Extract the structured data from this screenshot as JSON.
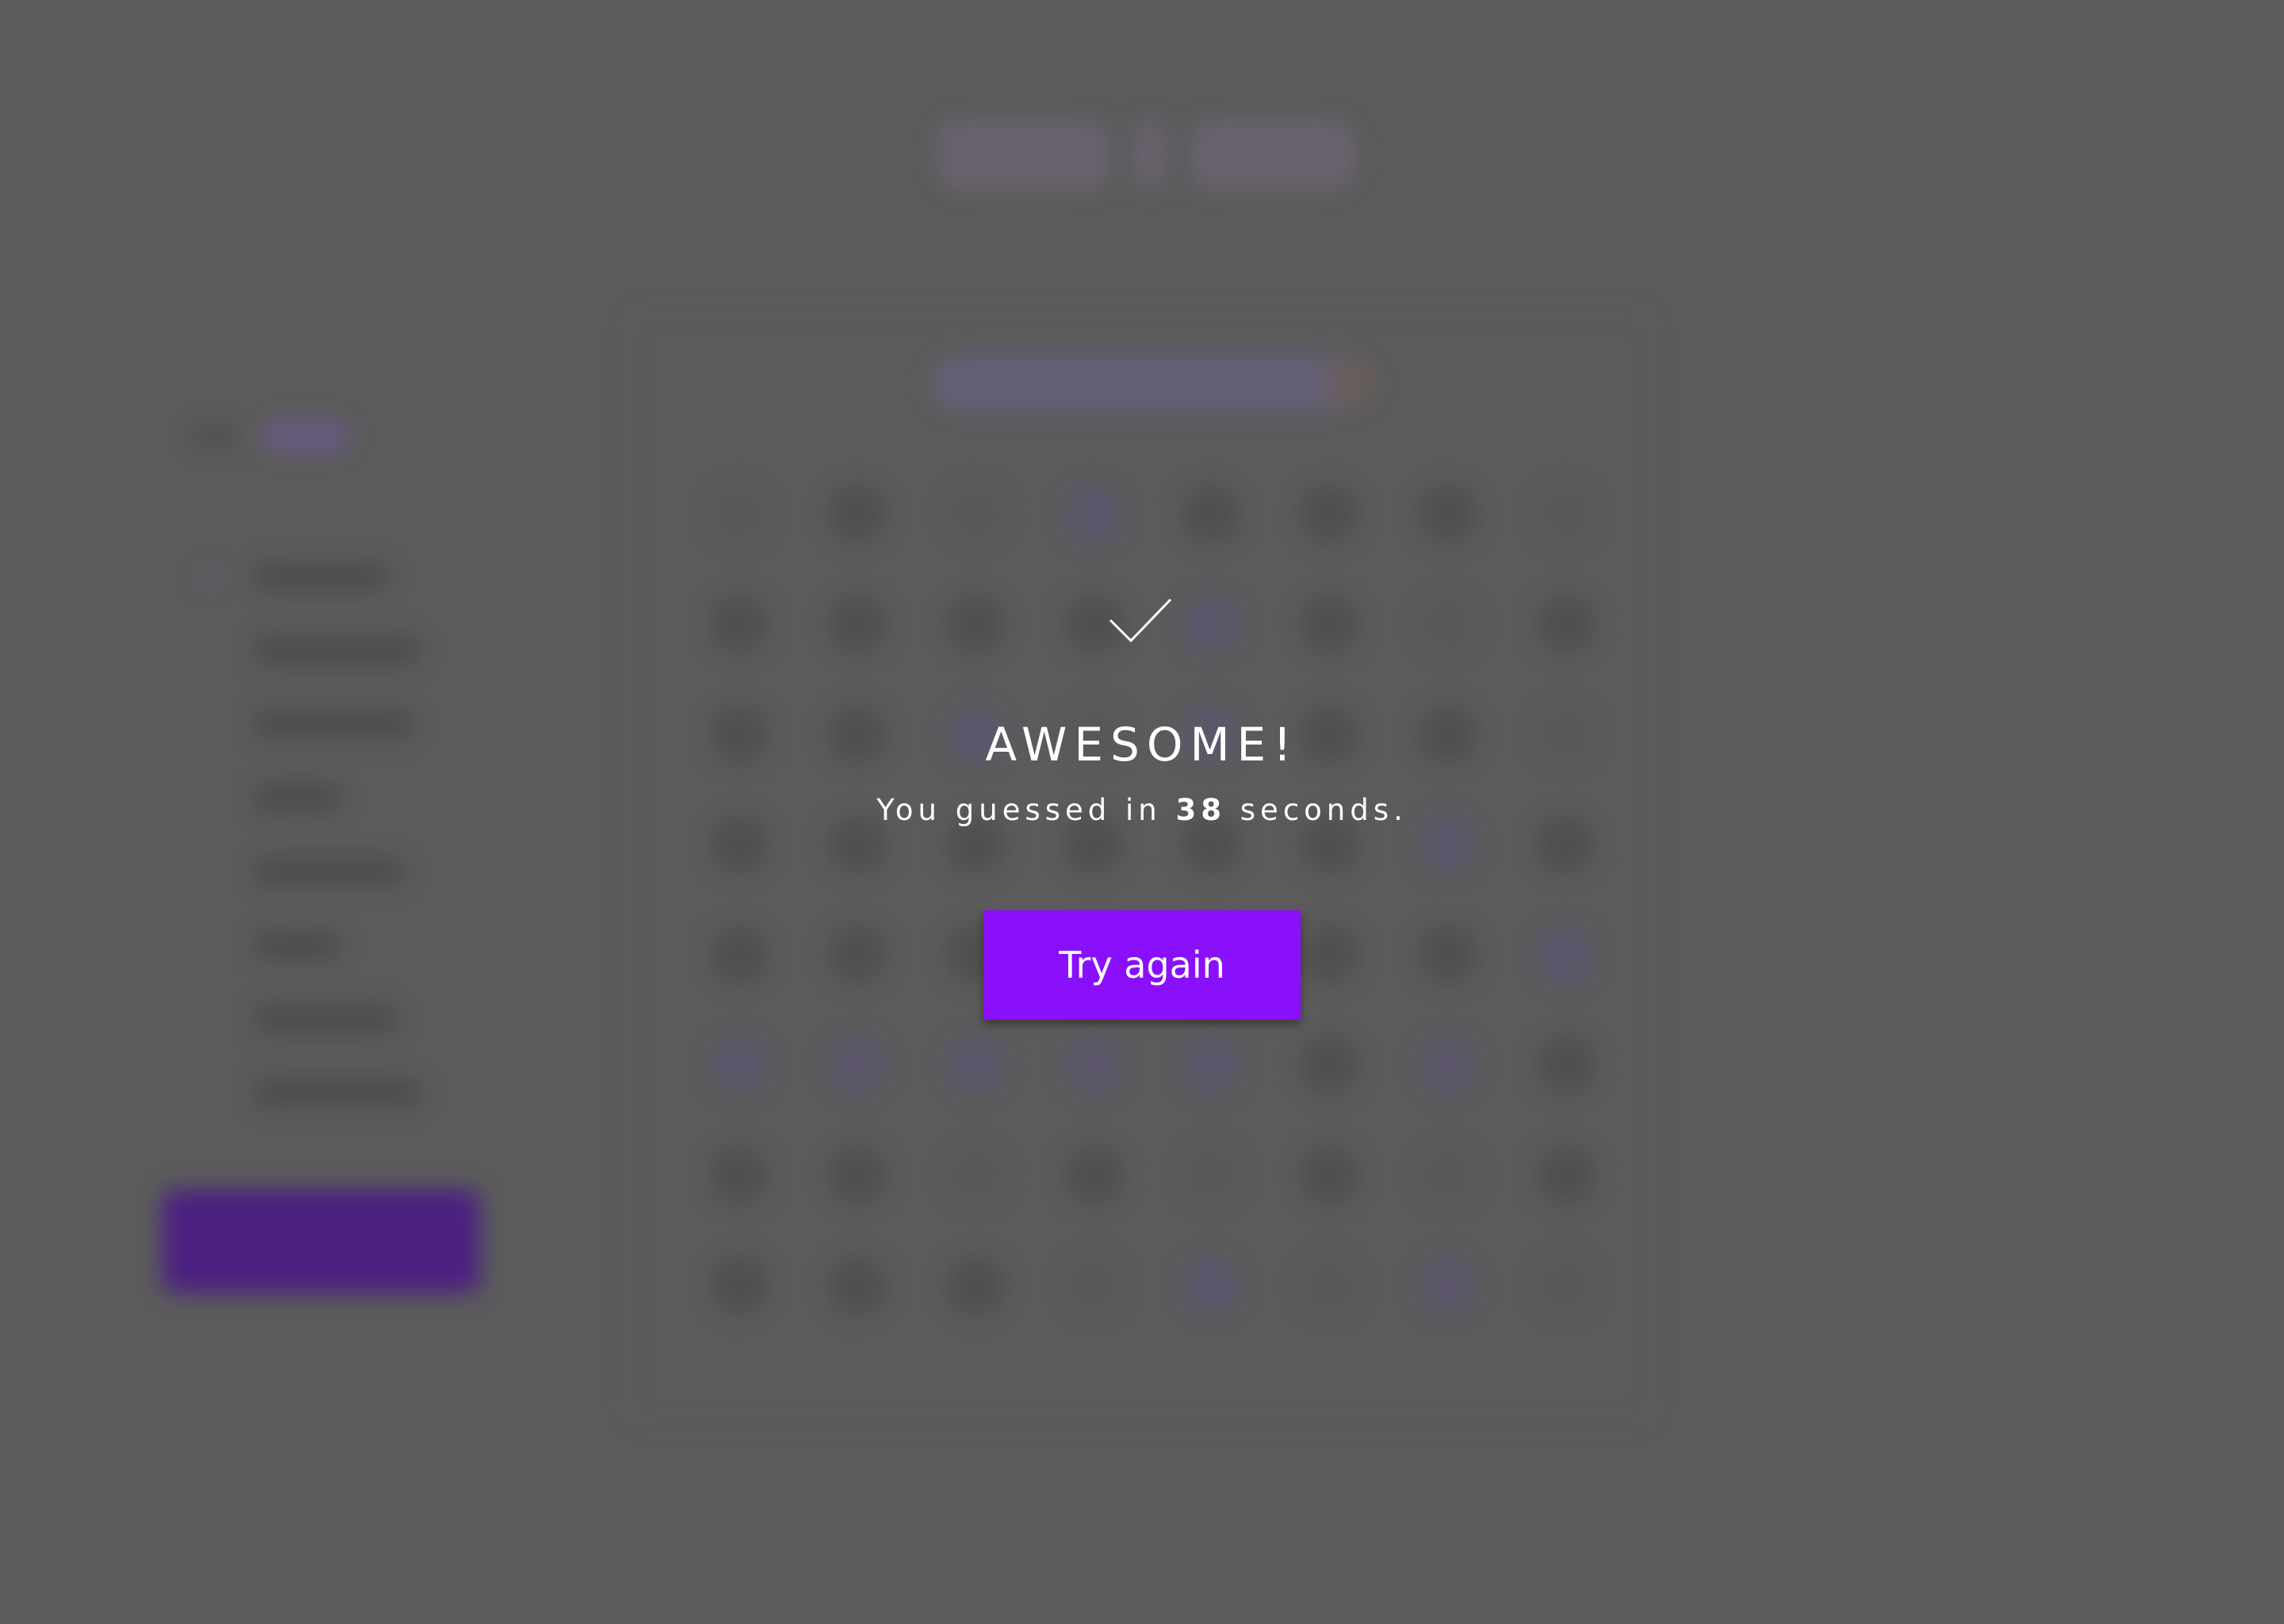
{
  "dialog": {
    "title": "AWESOME!",
    "message_prefix": "You guessed in",
    "seconds": "38",
    "message_suffix": "seconds.",
    "button_label": "Try again",
    "icon": "checkmark-icon"
  },
  "colors": {
    "backdrop": "#5b5b5b",
    "accent": "#8a10fb",
    "text": "#ffffff"
  }
}
